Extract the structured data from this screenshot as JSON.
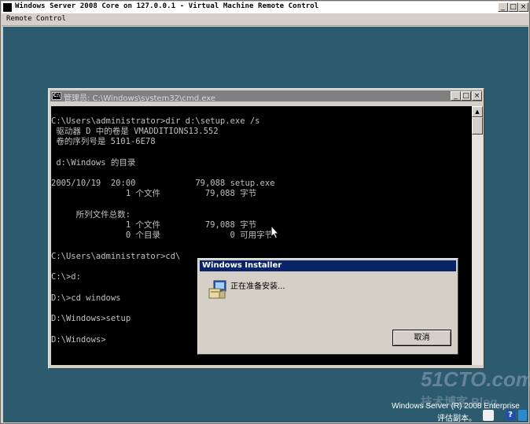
{
  "outer_window": {
    "title": "Windows Server 2008 Core on 127.0.0.1 - Virtual Machine Remote Control",
    "minimize": "_",
    "maximize": "□",
    "close": "×"
  },
  "menubar": {
    "remote_control": "Remote Control"
  },
  "cmd_window": {
    "title": "管理员: C:\\Windows\\system32\\cmd.exe",
    "icon_text": "C:\\",
    "minimize": "_",
    "maximize": "□",
    "close": "×",
    "lines": [
      "C:\\Users\\administrator>dir d:\\setup.exe /s",
      " 驱动器 D 中的卷是 VMADDITIONS13.552",
      " 卷的序列号是 5101-6E78",
      "",
      " d:\\Windows 的目录",
      "",
      "2005/10/19  20:00            79,088 setup.exe",
      "               1 个文件         79,088 字节",
      "",
      "     所列文件总数:",
      "               1 个文件         79,088 字节",
      "               0 个目录              0 可用字节",
      "",
      "C:\\Users\\administrator>cd\\",
      "",
      "C:\\>d:",
      "",
      "D:\\>cd windows",
      "",
      "D:\\Windows>setup",
      "",
      "D:\\Windows>"
    ],
    "scroll_up": "▲"
  },
  "installer_dialog": {
    "title": "Windows Installer",
    "message": "正在准备安装...",
    "cancel_label": "取消"
  },
  "watermark": {
    "site": "51CTO.com",
    "blog": "技术博客  Blog",
    "os_edition": "Windows Server (R) 2008 Enterprise",
    "eval_copy": "评估副本。"
  }
}
